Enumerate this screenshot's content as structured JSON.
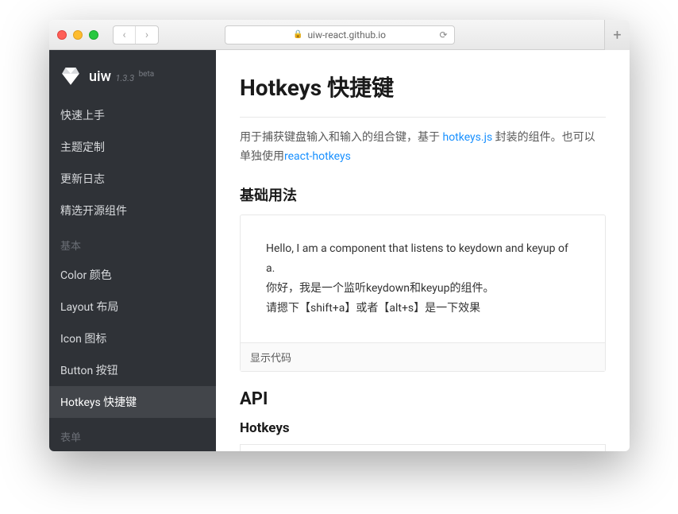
{
  "browser": {
    "url": "uiw-react.github.io"
  },
  "sidebar": {
    "logo": {
      "name": "uiw",
      "version": "1.3.3",
      "tag": "beta"
    },
    "guide": [
      {
        "label": "快速上手"
      },
      {
        "label": "主题定制"
      },
      {
        "label": "更新日志"
      },
      {
        "label": "精选开源组件"
      }
    ],
    "sections": [
      {
        "title": "基本",
        "items": [
          {
            "label": "Color 颜色"
          },
          {
            "label": "Layout 布局"
          },
          {
            "label": "Icon 图标"
          },
          {
            "label": "Button 按钮"
          },
          {
            "label": "Hotkeys 快捷键",
            "active": true
          }
        ]
      },
      {
        "title": "表单",
        "items": []
      }
    ]
  },
  "main": {
    "title": "Hotkeys 快捷键",
    "intro_pre": "用于捕获键盘输入和输入的组合键，基于 ",
    "intro_link1": "hotkeys.js",
    "intro_mid": " 封装的组件。也可以单独使用",
    "intro_link2": "react-hotkeys",
    "basic_title": "基础用法",
    "demo": {
      "line1": "Hello, I am a component that listens to keydown and keyup of a.",
      "line2": "你好，我是一个监听keydown和keyup的组件。",
      "line3": "请摁下【shift+a】或者【alt+s】是一下效果",
      "footer": "显示代码"
    },
    "api_title": "API",
    "hotkeys_sub": "Hotkeys"
  }
}
